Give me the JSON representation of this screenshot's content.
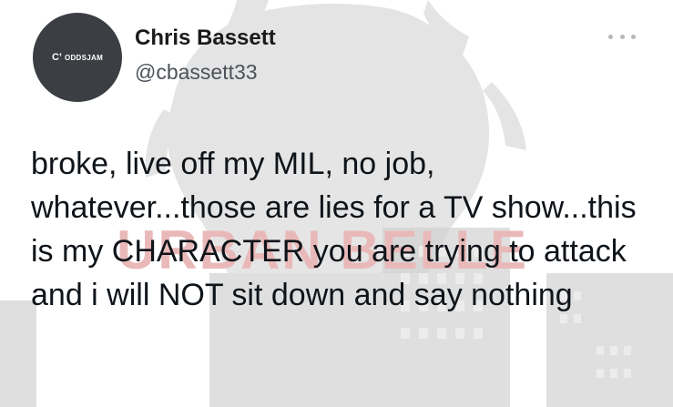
{
  "tweet": {
    "display_name": "Chris Bassett",
    "handle": "@cbassett33",
    "text": "broke, live off my MIL, no job, whatever...those are lies for a TV show...this is my CHARACTER you are trying to attack and i will NOT sit down and say nothing"
  },
  "avatar": {
    "logo_text": "ODDSJAM",
    "logo_mark": "C’",
    "background": "#3b3e43"
  },
  "background": {
    "watermark_text": "URBAN BELLE"
  },
  "icons": {
    "more": "more-horizontal-icon"
  },
  "colors": {
    "text": "#0f1419",
    "secondary_text": "#4b5259",
    "watermark": "#e9b9b9"
  }
}
